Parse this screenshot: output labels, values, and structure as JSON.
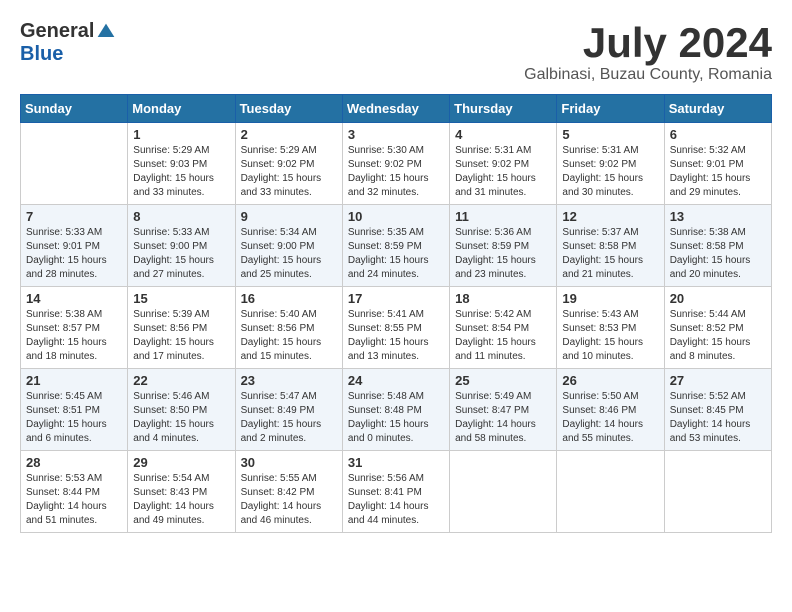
{
  "header": {
    "logo": {
      "general": "General",
      "blue": "Blue"
    },
    "title": "July 2024",
    "location": "Galbinasi, Buzau County, Romania"
  },
  "weekdays": [
    "Sunday",
    "Monday",
    "Tuesday",
    "Wednesday",
    "Thursday",
    "Friday",
    "Saturday"
  ],
  "weeks": [
    [
      null,
      {
        "day": 1,
        "sunrise": "5:29 AM",
        "sunset": "9:03 PM",
        "daylight": "15 hours and 33 minutes."
      },
      {
        "day": 2,
        "sunrise": "5:29 AM",
        "sunset": "9:02 PM",
        "daylight": "15 hours and 33 minutes."
      },
      {
        "day": 3,
        "sunrise": "5:30 AM",
        "sunset": "9:02 PM",
        "daylight": "15 hours and 32 minutes."
      },
      {
        "day": 4,
        "sunrise": "5:31 AM",
        "sunset": "9:02 PM",
        "daylight": "15 hours and 31 minutes."
      },
      {
        "day": 5,
        "sunrise": "5:31 AM",
        "sunset": "9:02 PM",
        "daylight": "15 hours and 30 minutes."
      },
      {
        "day": 6,
        "sunrise": "5:32 AM",
        "sunset": "9:01 PM",
        "daylight": "15 hours and 29 minutes."
      }
    ],
    [
      {
        "day": 7,
        "sunrise": "5:33 AM",
        "sunset": "9:01 PM",
        "daylight": "15 hours and 28 minutes."
      },
      {
        "day": 8,
        "sunrise": "5:33 AM",
        "sunset": "9:00 PM",
        "daylight": "15 hours and 27 minutes."
      },
      {
        "day": 9,
        "sunrise": "5:34 AM",
        "sunset": "9:00 PM",
        "daylight": "15 hours and 25 minutes."
      },
      {
        "day": 10,
        "sunrise": "5:35 AM",
        "sunset": "8:59 PM",
        "daylight": "15 hours and 24 minutes."
      },
      {
        "day": 11,
        "sunrise": "5:36 AM",
        "sunset": "8:59 PM",
        "daylight": "15 hours and 23 minutes."
      },
      {
        "day": 12,
        "sunrise": "5:37 AM",
        "sunset": "8:58 PM",
        "daylight": "15 hours and 21 minutes."
      },
      {
        "day": 13,
        "sunrise": "5:38 AM",
        "sunset": "8:58 PM",
        "daylight": "15 hours and 20 minutes."
      }
    ],
    [
      {
        "day": 14,
        "sunrise": "5:38 AM",
        "sunset": "8:57 PM",
        "daylight": "15 hours and 18 minutes."
      },
      {
        "day": 15,
        "sunrise": "5:39 AM",
        "sunset": "8:56 PM",
        "daylight": "15 hours and 17 minutes."
      },
      {
        "day": 16,
        "sunrise": "5:40 AM",
        "sunset": "8:56 PM",
        "daylight": "15 hours and 15 minutes."
      },
      {
        "day": 17,
        "sunrise": "5:41 AM",
        "sunset": "8:55 PM",
        "daylight": "15 hours and 13 minutes."
      },
      {
        "day": 18,
        "sunrise": "5:42 AM",
        "sunset": "8:54 PM",
        "daylight": "15 hours and 11 minutes."
      },
      {
        "day": 19,
        "sunrise": "5:43 AM",
        "sunset": "8:53 PM",
        "daylight": "15 hours and 10 minutes."
      },
      {
        "day": 20,
        "sunrise": "5:44 AM",
        "sunset": "8:52 PM",
        "daylight": "15 hours and 8 minutes."
      }
    ],
    [
      {
        "day": 21,
        "sunrise": "5:45 AM",
        "sunset": "8:51 PM",
        "daylight": "15 hours and 6 minutes."
      },
      {
        "day": 22,
        "sunrise": "5:46 AM",
        "sunset": "8:50 PM",
        "daylight": "15 hours and 4 minutes."
      },
      {
        "day": 23,
        "sunrise": "5:47 AM",
        "sunset": "8:49 PM",
        "daylight": "15 hours and 2 minutes."
      },
      {
        "day": 24,
        "sunrise": "5:48 AM",
        "sunset": "8:48 PM",
        "daylight": "15 hours and 0 minutes."
      },
      {
        "day": 25,
        "sunrise": "5:49 AM",
        "sunset": "8:47 PM",
        "daylight": "14 hours and 58 minutes."
      },
      {
        "day": 26,
        "sunrise": "5:50 AM",
        "sunset": "8:46 PM",
        "daylight": "14 hours and 55 minutes."
      },
      {
        "day": 27,
        "sunrise": "5:52 AM",
        "sunset": "8:45 PM",
        "daylight": "14 hours and 53 minutes."
      }
    ],
    [
      {
        "day": 28,
        "sunrise": "5:53 AM",
        "sunset": "8:44 PM",
        "daylight": "14 hours and 51 minutes."
      },
      {
        "day": 29,
        "sunrise": "5:54 AM",
        "sunset": "8:43 PM",
        "daylight": "14 hours and 49 minutes."
      },
      {
        "day": 30,
        "sunrise": "5:55 AM",
        "sunset": "8:42 PM",
        "daylight": "14 hours and 46 minutes."
      },
      {
        "day": 31,
        "sunrise": "5:56 AM",
        "sunset": "8:41 PM",
        "daylight": "14 hours and 44 minutes."
      },
      null,
      null,
      null
    ]
  ]
}
